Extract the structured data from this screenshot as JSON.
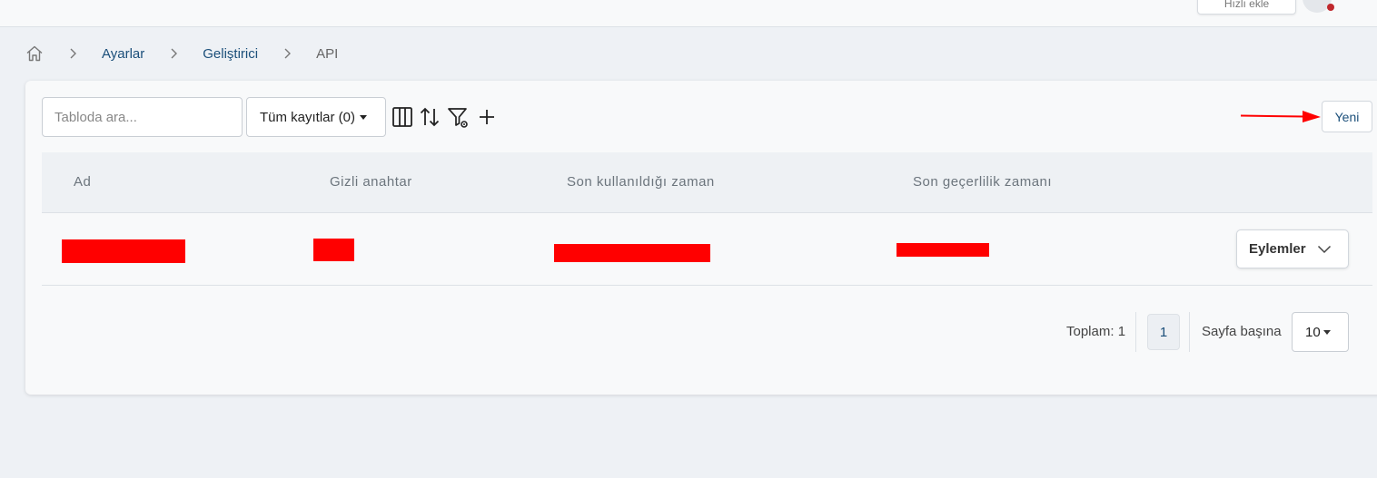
{
  "topbar": {
    "button_label": "Hızlı ekle"
  },
  "breadcrumb": {
    "items": [
      "Ayarlar",
      "Geliştirici",
      "API"
    ]
  },
  "toolbar": {
    "search_placeholder": "Tabloda ara...",
    "filter_label": "Tüm kayıtlar (0)",
    "new_label": "Yeni",
    "icons": [
      "columns-icon",
      "sort-icon",
      "filter-settings-icon",
      "plus-icon"
    ]
  },
  "table": {
    "headers": [
      "Ad",
      "Gizli anahtar",
      "Son kullanıldığı zaman",
      "Son geçerlilik zamanı"
    ],
    "rows": [
      {
        "actions_label": "Eylemler"
      }
    ]
  },
  "pagination": {
    "total_label": "Toplam: 1",
    "current_page": "1",
    "per_page_label": "Sayfa başına",
    "per_page_value": "10"
  },
  "colors": {
    "accent": "#1b4f7a",
    "redaction": "#ff0000",
    "annotation_arrow": "#ff0000"
  }
}
